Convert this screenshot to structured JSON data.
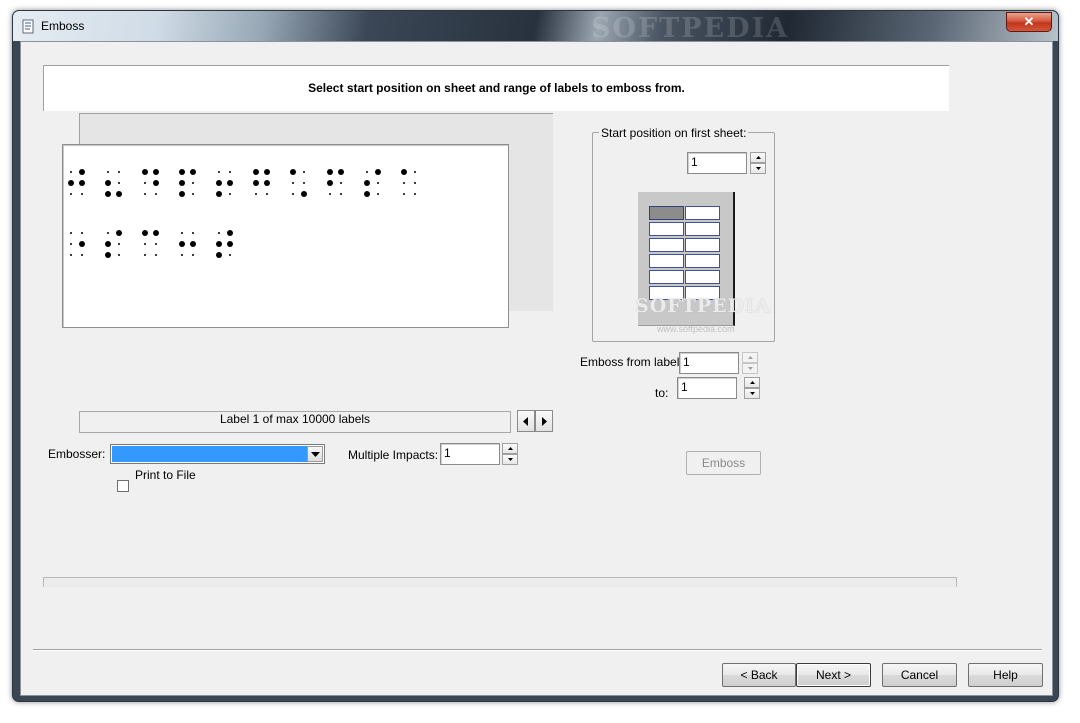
{
  "window": {
    "title": "Emboss",
    "watermark": "SOFTPEDIA",
    "close_icon": "close-icon",
    "app_icon": "document-icon"
  },
  "header": {
    "instruction": "Select start position on sheet and range of labels to emboss from."
  },
  "preview": {
    "label_counter": "Label 1 of max 10000 labels",
    "line1_cell_count": 10,
    "line2_cell_count": 5,
    "prev_icon": "arrow-left-icon",
    "next_icon": "arrow-right-icon"
  },
  "embosser": {
    "label": "Embosser:",
    "selected_value": "",
    "print_to_file_label": "Print to File",
    "print_to_file_checked": false,
    "multiple_impacts_label": "Multiple Impacts:",
    "multiple_impacts_value": "1"
  },
  "start_position": {
    "legend": "Start position on first sheet:",
    "value": "1",
    "sheet_rows": 6,
    "sheet_columns": 2,
    "active_cell": 1,
    "watermark": "SOFTPEDIA",
    "watermark_url": "www.softpedia.com"
  },
  "range": {
    "from_label": "Emboss from label",
    "from_value": "1",
    "to_label": "to:",
    "to_value": "1"
  },
  "buttons": {
    "emboss": "Emboss",
    "back": "< Back",
    "next": "Next >",
    "cancel": "Cancel",
    "help": "Help"
  },
  "colors": {
    "selection": "#3399ff",
    "close_button": "#c8412a",
    "sheet_cell_border": "#4050a0",
    "active_cell": "#8c8c8c"
  }
}
